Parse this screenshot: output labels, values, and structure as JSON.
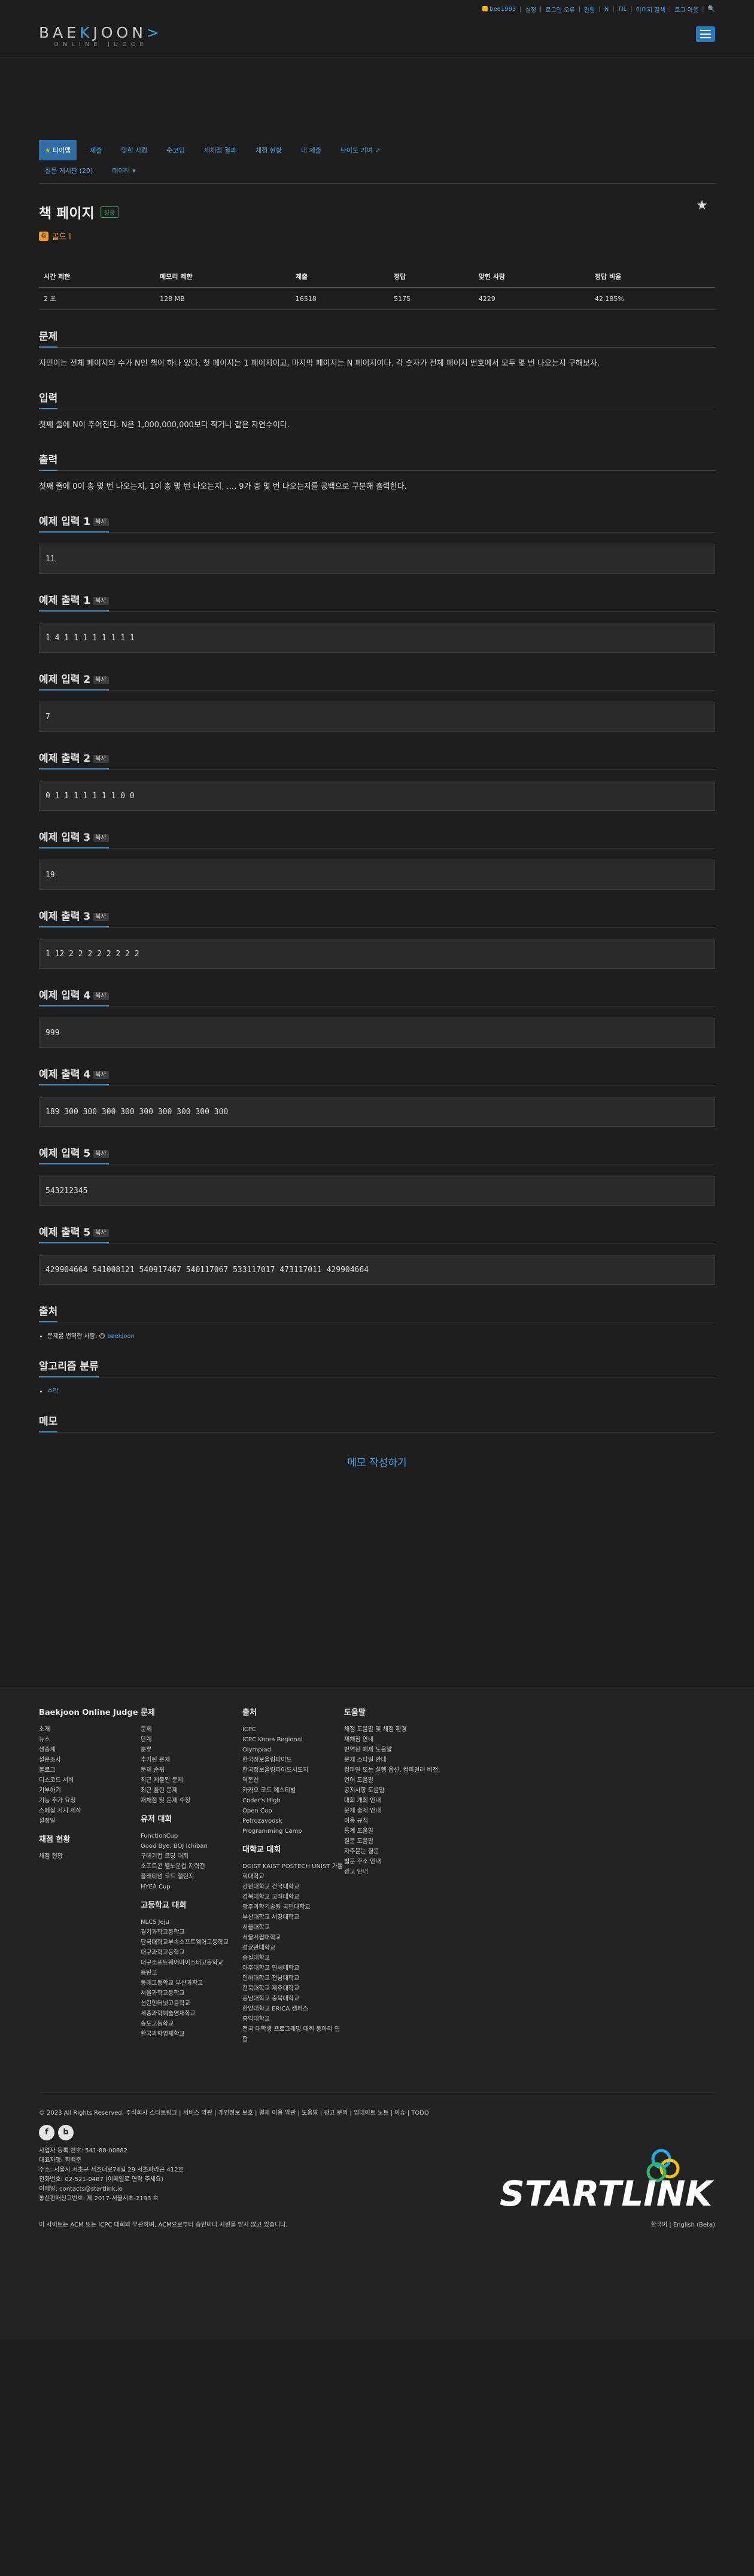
{
  "toplinks": [
    "bee1993",
    "설정",
    "로그인 오류",
    "알림",
    "N",
    "TIL",
    "이미지 검색",
    "로그 아웃",
    "검색"
  ],
  "logo": {
    "left": "BAE",
    "k": "K",
    "right": "JOON",
    "arrow": ">",
    "sub": "ONLINE JUDGE"
  },
  "tabs": [
    "티어맵",
    "제출",
    "맞힌 사람",
    "숏코딩",
    "재채점 결과",
    "채점 현황",
    "내 제출",
    "난이도 기여",
    "질문 게시판 (20)",
    "데이터"
  ],
  "problem": {
    "title": "책 페이지",
    "solved_badge": "성공",
    "star": "★",
    "tier": "골드 I",
    "tier_icon": "G",
    "info_headers": [
      "시간 제한",
      "메모리 제한",
      "제출",
      "정답",
      "맞힌 사람",
      "정답 비율"
    ],
    "info_values": [
      "2 초",
      "128 MB",
      "16518",
      "5175",
      "4229",
      "42.185%"
    ]
  },
  "sections": {
    "desc_title": "문제",
    "desc": "지민이는 전체 페이지의 수가 N인 책이 하나 있다. 첫 페이지는 1 페이지이고, 마지막 페이지는 N 페이지이다. 각 숫자가 전체 페이지 번호에서 모두 몇 번 나오는지 구해보자.",
    "input_title": "입력",
    "input": "첫째 줄에 N이 주어진다. N은 1,000,000,000보다 작거나 같은 자연수이다.",
    "output_title": "출력",
    "output": "첫째 줄에 0이 총 몇 번 나오는지, 1이 총 몇 번 나오는지, ..., 9가 총 몇 번 나오는지를 공백으로 구분해 출력한다.",
    "copy": "복사",
    "source_title": "출처",
    "source_text": "문제를 번역한 사람:",
    "source_user": "baekjoon",
    "algo_title": "알고리즘 분류",
    "algo_items": [
      "수학"
    ],
    "memo_title": "메모",
    "memo_button": "메모 작성하기"
  },
  "samples": [
    {
      "in_title": "예제 입력 1",
      "in": "11",
      "out_title": "예제 출력 1",
      "out": "1 4 1 1 1 1 1 1 1 1"
    },
    {
      "in_title": "예제 입력 2",
      "in": "7",
      "out_title": "예제 출력 2",
      "out": "0 1 1 1 1 1 1 1 0 0"
    },
    {
      "in_title": "예제 입력 3",
      "in": "19",
      "out_title": "예제 출력 3",
      "out": "1 12 2 2 2 2 2 2 2 2"
    },
    {
      "in_title": "예제 입력 4",
      "in": "999",
      "out_title": "예제 출력 4",
      "out": "189 300 300 300 300 300 300 300 300 300"
    },
    {
      "in_title": "예제 입력 5",
      "in": "543212345",
      "out_title": "예제 출력 5",
      "out": "429904664 541008121 540917467 540117067 533117017 473117011 429904664"
    }
  ],
  "footer": {
    "col1": {
      "title": "Baekjoon Online Judge",
      "items": [
        "소개",
        "뉴스",
        "생중계",
        "설문조사",
        "블로그",
        "디스코드 서버",
        "기부하기",
        "기능 추가 요청",
        "스페셜 저지 제작",
        "설정일"
      ],
      "title2": "채점 현황",
      "items2": [
        "채점 현황"
      ]
    },
    "col2": {
      "title": "문제",
      "items": [
        "문제",
        "단계",
        "분류",
        "추가된 문제",
        "문제 순위",
        "최근 제출된 문제",
        "최근 풀린 문제",
        "재채점 및 문제 수정"
      ],
      "title2": "유저 대회",
      "items2": [
        "FunctionCup",
        "Good Bye, BOJ Ichiban",
        "구데기컵 코딩 대회",
        "소프트콘 웰노운컵 지력전",
        "플래티넘 코드 챌린지",
        "HYEA Cup"
      ],
      "title3": "고등학교 대회",
      "items3": [
        "NLCS Jeju",
        "경기과학고등학교",
        "단국대학교부속소프트웨어고등학교",
        "대구과학고등학교",
        "대구소프트웨어마이스터고등학교",
        "동탄고",
        "동래고등학교 부산과학고",
        "서울과학고등학교",
        "선린인터넷고등학교",
        "세종과학예술영재학교",
        "송도고등학교",
        "한국과학영재학교"
      ]
    },
    "col3": {
      "title": "출처",
      "items": [
        "ICPC",
        "ICPC Korea Regional",
        "Olympiad",
        "한국정보올림피아드",
        "한국정보올림피아드시도지",
        "역돈선",
        "카카오 코드 페스티벌",
        "Coder's High",
        "Open Cup",
        "Petrozavodsk",
        "Programming Camp"
      ],
      "title2": "대학교 대회",
      "items2": [
        "DGIST KAIST POSTECH UNIST 가톨릭대학교",
        "강원대학교 건국대학교",
        "경북대학교 고려대학교",
        "광주과학기술원 국민대학교",
        "부산대학교 서강대학교",
        "서울대학교",
        "서울시립대학교",
        "성균관대학교",
        "숭실대학교",
        "아주대학교 연세대학교",
        "인하대학교 전남대학교",
        "전북대학교 제주대학교",
        "충남대학교 충북대학교",
        "한양대학교 ERICA 캠퍼스",
        "홍익대학교",
        "전국 대학생 프로그래밍 대회 동아리 연합"
      ]
    },
    "col4": {
      "title": "도움말",
      "items": [
        "채점 도움말 및 채점 환경",
        "재채점 안내",
        "번역된 예제 도움말",
        "문제 스타일 안내",
        "컴파일 또는 실행 옵션, 컴파일러 버전, 언어 도움말",
        "공지사항 도움말",
        "대회 개최 안내",
        "문제 출제 안내",
        "이용 규칙",
        "통계 도움말",
        "질문 도움말",
        "자주묻는 질문",
        "별문 주소 안내",
        "광고 안내"
      ]
    },
    "copyright": "© 2023 All Rights Reserved. 주식회사 스타트링크 | 서비스 약관 | 개인정보 보호 | 결제 이용 약관 | 도움말 | 광고 문의 | 업데이트 노트 | 이슈 | TODO",
    "social": [
      "f",
      "b"
    ],
    "biz": [
      "사업자 등록 번호: 541-88-00682",
      "대표자명: 최백준",
      "주소: 서울시 서초구 서초대로74길 29 서초파라곤 412호",
      "전화번호: 02-521-0487 (이메일로 연락 주세요)",
      "이메일: contacts@startlink.io",
      "통신판매신고번호: 제 2017-서울서초-2193 호"
    ],
    "startlink": "STARTLINK",
    "notice": "이 사이트는 ACM 또는 ICPC 대회와 무관하며, ACM으로부터 승인이나 지원을 받지 않고 있습니다.",
    "lang": "한국어 | English (Beta)"
  },
  "colors": {
    "accent": "#4fa3e0",
    "tier": "#ec9a29",
    "bg": "#1e1e1e"
  }
}
